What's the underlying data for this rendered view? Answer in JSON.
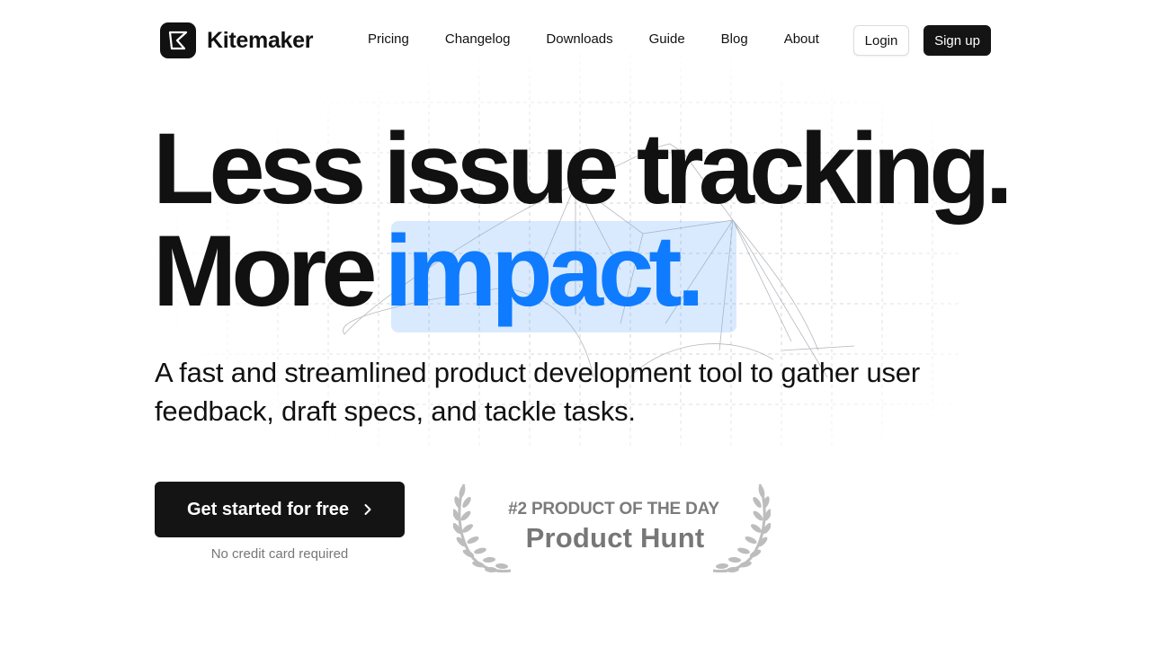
{
  "brand": {
    "name": "Kitemaker",
    "logo_icon": "kite-logo-icon"
  },
  "nav": {
    "items": [
      {
        "label": "Pricing"
      },
      {
        "label": "Changelog"
      },
      {
        "label": "Downloads"
      },
      {
        "label": "Guide"
      },
      {
        "label": "Blog"
      },
      {
        "label": "About"
      }
    ],
    "login_label": "Login",
    "signup_label": "Sign up"
  },
  "hero": {
    "headline_line1": "Less issue tracking.",
    "headline_line2_prefix": "More",
    "headline_line2_highlight": "impact.",
    "subtitle": "A fast and streamlined product development tool to gather user feedback, draft specs, and tackle tasks.",
    "cta_label": "Get started for free",
    "cta_icon": "chevron-right-icon",
    "cta_note": "No credit card required"
  },
  "award": {
    "rank": "#2 PRODUCT OF THE DAY",
    "name": "Product Hunt",
    "icon": "laurel-wreath-icon"
  },
  "colors": {
    "text": "#111111",
    "accent": "#0f7bff",
    "highlight_bg": "#d6e8fd",
    "button_dark": "#141414",
    "muted": "#777777"
  }
}
